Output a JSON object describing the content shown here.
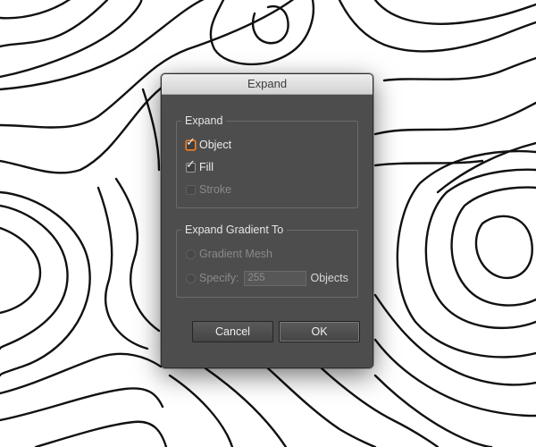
{
  "dialog": {
    "title": "Expand",
    "expand_group": {
      "legend": "Expand",
      "object": {
        "label": "Object",
        "checked": true,
        "focused": true
      },
      "fill": {
        "label": "Fill",
        "checked": true
      },
      "stroke": {
        "label": "Stroke",
        "checked": false,
        "disabled": true
      }
    },
    "gradient_group": {
      "legend": "Expand Gradient To",
      "gradient_mesh": {
        "label": "Gradient Mesh",
        "disabled": true
      },
      "specify": {
        "label": "Specify:",
        "value": "255",
        "units": "Objects",
        "disabled": true
      }
    },
    "buttons": {
      "cancel": "Cancel",
      "ok": "OK"
    }
  },
  "icons": {
    "check": "✓"
  },
  "colors": {
    "dialog_bg": "#4d4d4d",
    "focus_ring": "#e8873a"
  }
}
